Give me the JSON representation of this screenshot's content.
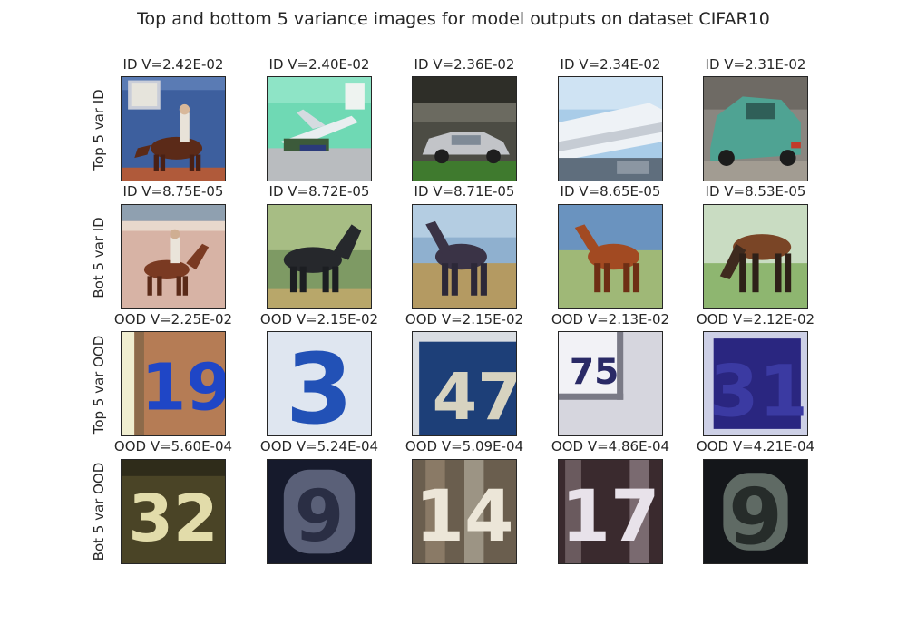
{
  "figure": {
    "title": "Top and bottom 5 variance images for model outputs on dataset CIFAR10"
  },
  "rows": [
    {
      "label": "Top 5 var ID",
      "cells": [
        {
          "title": "ID V=2.42E-02",
          "icon": "horse-rider-image"
        },
        {
          "title": "ID V=2.40E-02",
          "icon": "airplane-image"
        },
        {
          "title": "ID V=2.36E-02",
          "icon": "car-image"
        },
        {
          "title": "ID V=2.34E-02",
          "icon": "ship-image"
        },
        {
          "title": "ID V=2.31E-02",
          "icon": "car-image"
        }
      ]
    },
    {
      "label": "Bot 5 var ID",
      "cells": [
        {
          "title": "ID V=8.75E-05",
          "icon": "horse-rider-image"
        },
        {
          "title": "ID V=8.72E-05",
          "icon": "horse-image"
        },
        {
          "title": "ID V=8.71E-05",
          "icon": "horse-image"
        },
        {
          "title": "ID V=8.65E-05",
          "icon": "horse-image"
        },
        {
          "title": "ID V=8.53E-05",
          "icon": "horse-image"
        }
      ]
    },
    {
      "label": "Top 5 var OOD",
      "cells": [
        {
          "title": "OOD V=2.25E-02",
          "icon": "digit-image",
          "digits": "19"
        },
        {
          "title": "OOD V=2.15E-02",
          "icon": "digit-image",
          "digits": "3"
        },
        {
          "title": "OOD V=2.15E-02",
          "icon": "digit-image",
          "digits": "47"
        },
        {
          "title": "OOD V=2.13E-02",
          "icon": "digit-image",
          "digits": "75"
        },
        {
          "title": "OOD V=2.12E-02",
          "icon": "digit-image",
          "digits": "31"
        }
      ]
    },
    {
      "label": "Bot 5 var OOD",
      "cells": [
        {
          "title": "OOD V=5.60E-04",
          "icon": "digit-image",
          "digits": "32"
        },
        {
          "title": "OOD V=5.24E-04",
          "icon": "digit-image",
          "digits": "9"
        },
        {
          "title": "OOD V=5.09E-04",
          "icon": "digit-image",
          "digits": "14"
        },
        {
          "title": "OOD V=4.86E-04",
          "icon": "digit-image",
          "digits": "17"
        },
        {
          "title": "OOD V=4.21E-04",
          "icon": "digit-image",
          "digits": "9"
        }
      ]
    }
  ]
}
